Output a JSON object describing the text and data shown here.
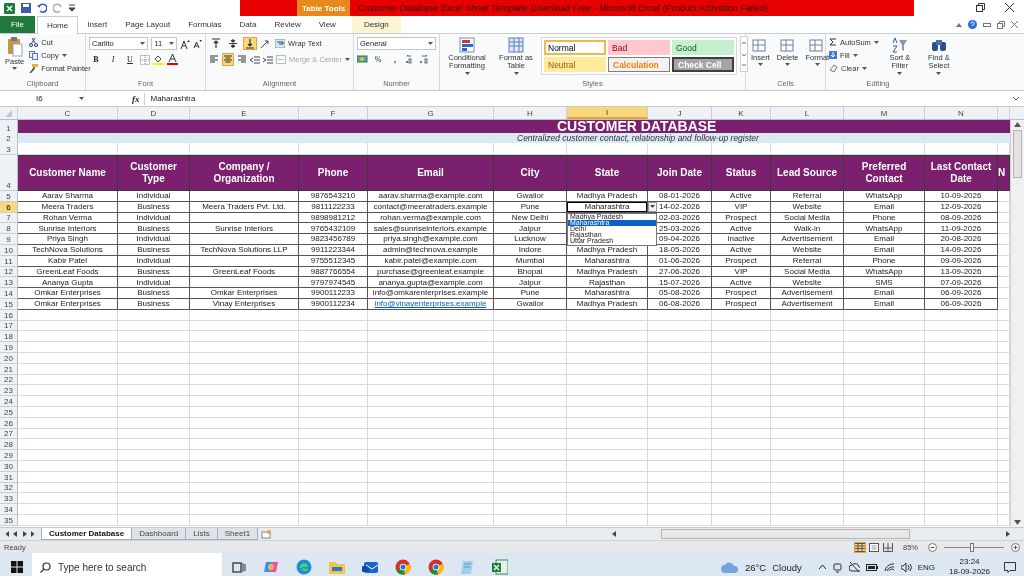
{
  "title_bar": {
    "context_tab": "Table Tools",
    "title": "Customer Database Excel Sheet Template Download Free  -  Microsoft Excel (Product Activation Failed)"
  },
  "ribbon_tabs": [
    {
      "label": "File",
      "kind": "file",
      "selected": false
    },
    {
      "label": "Home",
      "kind": "tab",
      "selected": true
    },
    {
      "label": "Insert",
      "kind": "tab",
      "selected": false
    },
    {
      "label": "Page Layout",
      "kind": "tab",
      "selected": false
    },
    {
      "label": "Formulas",
      "kind": "tab",
      "selected": false
    },
    {
      "label": "Data",
      "kind": "tab",
      "selected": false
    },
    {
      "label": "Review",
      "kind": "tab",
      "selected": false
    },
    {
      "label": "View",
      "kind": "tab",
      "selected": false
    },
    {
      "label": "Design",
      "kind": "context",
      "selected": false
    }
  ],
  "ribbon": {
    "clipboard": {
      "label": "Clipboard",
      "paste": "Paste",
      "cut": "Cut",
      "copy": "Copy",
      "format_painter": "Format Painter"
    },
    "font": {
      "label": "Font",
      "font_name": "Carlito",
      "font_size": "11",
      "bold": "B",
      "italic": "I",
      "underline": "U"
    },
    "alignment": {
      "label": "Alignment",
      "vertical_buttons": [
        {
          "selected": false
        },
        {
          "selected": false
        },
        {
          "selected": true
        }
      ],
      "horizontal_buttons": [
        {
          "selected": false
        },
        {
          "selected": true
        },
        {
          "selected": false
        }
      ],
      "wrap_text": "Wrap Text",
      "merge_center": {
        "label": "Merge & Center",
        "disabled": true
      }
    },
    "number": {
      "label": "Number",
      "format": "General",
      "percent": "%",
      "comma": ","
    },
    "styles": {
      "label": "Styles",
      "conditional_formatting": "Conditional Formatting",
      "format_as_table": "Format as Table",
      "cell_styles": [
        {
          "label": "Normal",
          "kind": "normal",
          "selected": true
        },
        {
          "label": "Bad",
          "kind": "bad",
          "selected": false
        },
        {
          "label": "Good",
          "kind": "good",
          "selected": false
        },
        {
          "label": "Neutral",
          "kind": "neutral",
          "selected": false
        },
        {
          "label": "Calculation",
          "kind": "calculation",
          "selected": false
        },
        {
          "label": "Check Cell",
          "kind": "check",
          "selected": false
        }
      ]
    },
    "cells": {
      "label": "Cells",
      "buttons": [
        "Insert",
        "Delete",
        "Format"
      ]
    },
    "editing": {
      "label": "Editing",
      "autosum": "AutoSum",
      "fill": "Fill",
      "clear": "Clear",
      "sort_filter": "Sort & Filter",
      "find_select": "Find & Select"
    }
  },
  "formula_bar": {
    "name_box": "I6",
    "function_label": "fx",
    "value": "Maharashtra"
  },
  "sheet": {
    "column_letters": [
      {
        "label": "C",
        "selected": false
      },
      {
        "label": "D",
        "selected": false
      },
      {
        "label": "E",
        "selected": false
      },
      {
        "label": "F",
        "selected": false
      },
      {
        "label": "G",
        "selected": false
      },
      {
        "label": "H",
        "selected": false
      },
      {
        "label": "I",
        "selected": true
      },
      {
        "label": "J",
        "selected": false
      },
      {
        "label": "K",
        "selected": false
      },
      {
        "label": "L",
        "selected": false
      },
      {
        "label": "M",
        "selected": false
      },
      {
        "label": "N",
        "selected": false
      }
    ],
    "row_numbers": [
      {
        "label": "1",
        "selected": false
      },
      {
        "label": "2",
        "selected": false
      },
      {
        "label": "3",
        "selected": false
      },
      {
        "label": "4",
        "selected": false
      },
      {
        "label": "5",
        "selected": false
      },
      {
        "label": "6",
        "selected": true
      },
      {
        "label": "7",
        "selected": false
      },
      {
        "label": "8",
        "selected": false
      },
      {
        "label": "9",
        "selected": false
      },
      {
        "label": "10",
        "selected": false
      },
      {
        "label": "11",
        "selected": false
      },
      {
        "label": "12",
        "selected": false
      },
      {
        "label": "13",
        "selected": false
      },
      {
        "label": "14",
        "selected": false
      },
      {
        "label": "15",
        "selected": false
      },
      {
        "label": "16",
        "selected": false
      },
      {
        "label": "17",
        "selected": false
      },
      {
        "label": "18",
        "selected": false
      },
      {
        "label": "19",
        "selected": false
      },
      {
        "label": "20",
        "selected": false
      },
      {
        "label": "21",
        "selected": false
      },
      {
        "label": "22",
        "selected": false
      },
      {
        "label": "23",
        "selected": false
      },
      {
        "label": "24",
        "selected": false
      },
      {
        "label": "25",
        "selected": false
      },
      {
        "label": "26",
        "selected": false
      },
      {
        "label": "27",
        "selected": false
      },
      {
        "label": "28",
        "selected": false
      },
      {
        "label": "29",
        "selected": false
      },
      {
        "label": "30",
        "selected": false
      },
      {
        "label": "31",
        "selected": false
      },
      {
        "label": "32",
        "selected": false
      },
      {
        "label": "33",
        "selected": false
      },
      {
        "label": "34",
        "selected": false
      },
      {
        "label": "35",
        "selected": false
      }
    ],
    "title": "CUSTOMER DATABASE",
    "subtitle": "Centralized customer contact, relationship and follow-up register",
    "columns": [
      "Customer Name",
      "Customer Type",
      "Company / Organization",
      "Phone",
      "Email",
      "City",
      "State",
      "Join Date",
      "Status",
      "Lead Source",
      "Preferred Contact",
      "Last Contact Date",
      "N"
    ],
    "rows": [
      {
        "name": "Aarav Sharma",
        "type": "Individual",
        "phone": "9876543210",
        "email": "aarav.sharma@example.com",
        "city": "Gwalior",
        "state": "Madhya Pradesh",
        "join_date": "08-01-2026",
        "status": "Active",
        "lead_source": "Referral",
        "preferred_contact": "WhatsApp",
        "last_contact": "10-09-2026",
        "email_link": false,
        "state_selected": false
      },
      {
        "name": "Meera Traders",
        "type": "Business",
        "company": "Meera Traders Pvt. Ltd.",
        "phone": "9811122233",
        "email": "contact@meeratraders.example",
        "city": "Pune",
        "state": "Maharashtra",
        "join_date": "14-02-2026",
        "status": "VIP",
        "lead_source": "Website",
        "preferred_contact": "Email",
        "last_contact": "12-09-2026",
        "email_link": false,
        "state_selected": true
      },
      {
        "name": "Rohan Verma",
        "type": "Individual",
        "phone": "9898981212",
        "email": "rohan.verma@example.com",
        "city": "New Delhi",
        "join_date": "02-03-2026",
        "status": "Prospect",
        "lead_source": "Social Media",
        "preferred_contact": "Phone",
        "last_contact": "08-09-2026",
        "email_link": false,
        "state_selected": false
      },
      {
        "name": "Sunrise Interiors",
        "type": "Business",
        "company": "Sunrise Interiors",
        "phone": "9765432109",
        "email": "sales@sunriseinteriors.example",
        "city": "Jaipur",
        "join_date": "25-03-2026",
        "status": "Active",
        "lead_source": "Walk-in",
        "preferred_contact": "WhatsApp",
        "last_contact": "11-09-2026",
        "email_link": false,
        "state_selected": false
      },
      {
        "name": "Priya Singh",
        "type": "Individual",
        "phone": "9823456789",
        "email": "priya.singh@example.com",
        "city": "Lucknow",
        "join_date": "09-04-2026",
        "status": "Inactive",
        "lead_source": "Advertisement",
        "preferred_contact": "Email",
        "last_contact": "20-08-2026",
        "email_link": false,
        "state_selected": false
      },
      {
        "name": "TechNova Solutions",
        "type": "Business",
        "company": "TechNova Solutions LLP",
        "phone": "9911223344",
        "email": "admin@technova.example",
        "city": "Indore",
        "state": "Madhya Pradesh",
        "join_date": "18-05-2026",
        "status": "Active",
        "lead_source": "Website",
        "preferred_contact": "Email",
        "last_contact": "14-09-2026",
        "email_link": false,
        "state_selected": false
      },
      {
        "name": "Kabir Patel",
        "type": "Individual",
        "phone": "9755512345",
        "email": "kabir.patel@example.com",
        "city": "Mumbai",
        "state": "Maharashtra",
        "join_date": "01-06-2026",
        "status": "Prospect",
        "lead_source": "Referral",
        "preferred_contact": "Phone",
        "last_contact": "09-09-2026",
        "email_link": false,
        "state_selected": false
      },
      {
        "name": "GreenLeaf Foods",
        "type": "Business",
        "company": "GreenLeaf Foods",
        "phone": "9887766554",
        "email": "purchase@greenleaf.example",
        "city": "Bhopal",
        "state": "Madhya Pradesh",
        "join_date": "27-06-2026",
        "status": "VIP",
        "lead_source": "Social Media",
        "preferred_contact": "WhatsApp",
        "last_contact": "13-09-2026",
        "email_link": false,
        "state_selected": false
      },
      {
        "name": "Ananya Gupta",
        "type": "Individual",
        "phone": "9797974545",
        "email": "ananya.gupta@example.com",
        "city": "Jaipur",
        "state": "Rajasthan",
        "join_date": "15-07-2026",
        "status": "Active",
        "lead_source": "Website",
        "preferred_contact": "SMS",
        "last_contact": "07-09-2026",
        "email_link": false,
        "state_selected": false
      },
      {
        "name": "Omkar Enterprises",
        "type": "Business",
        "company": "Omkar Enterprises",
        "phone": "9900112233",
        "email": "info@omkarenterprises.example",
        "city": "Pune",
        "state": "Maharashtra",
        "join_date": "05-08-2026",
        "status": "Prospect",
        "lead_source": "Advertisement",
        "preferred_contact": "Email",
        "last_contact": "06-09-2026",
        "email_link": false,
        "state_selected": false
      },
      {
        "name": "Omkar Enterprises",
        "type": "Business",
        "company": "Vinay Enterprises",
        "phone": "9900112234",
        "email": "info@vinayenterprises.example",
        "city": "Gwalior",
        "state": "Madhya Pradesh",
        "join_date": "06-08-2026",
        "status": "Prospect",
        "lead_source": "Advertisement",
        "preferred_contact": "Email",
        "last_contact": "06-09-2026",
        "email_link": true,
        "state_selected": false
      }
    ],
    "dropdown": [
      {
        "label": "Madhya Pradesh",
        "selected": false
      },
      {
        "label": "Maharashtra",
        "selected": true
      },
      {
        "label": "Delhi",
        "selected": false
      },
      {
        "label": "Rajasthan",
        "selected": false
      },
      {
        "label": "Uttar Pradesh",
        "selected": false
      }
    ]
  },
  "sheet_tabs": [
    {
      "label": "Customer Database",
      "selected": true
    },
    {
      "label": "Dashboard",
      "selected": false
    },
    {
      "label": "Lists",
      "selected": false
    },
    {
      "label": "Sheet1",
      "selected": false
    }
  ],
  "status_bar": {
    "status": "Ready",
    "zoom": "85%",
    "zoom_slider": {
      "level": 0.46
    }
  },
  "taskbar": {
    "search_placeholder": "Type here to search",
    "temperature": "26°C",
    "weather": "Cloudy",
    "language": "ENG",
    "time": "23:24",
    "date": "18-09-2026"
  }
}
